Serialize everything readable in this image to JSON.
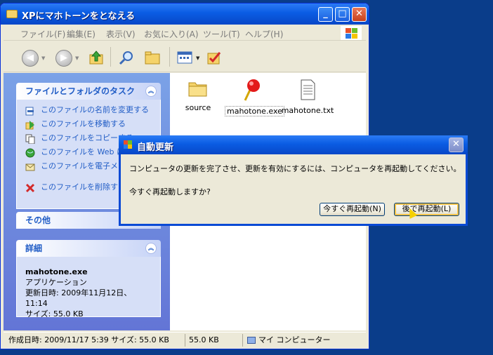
{
  "window": {
    "title": "XPにマホトーンをとなえる",
    "buttons": {
      "minimize": "_",
      "maximize": "□",
      "close": "✕"
    }
  },
  "menu": [
    "ファイル(F)",
    "編集(E)",
    "表示(V)",
    "お気に入り(A)",
    "ツール(T)",
    "ヘルプ(H)"
  ],
  "toolbar": {
    "back": "icon",
    "forward": "icon"
  },
  "task_panel": {
    "title": "ファイルとフォルダのタスク",
    "items": [
      "このファイルの名前を変更する",
      "このファイルを移動する",
      "このファイルをコピーする",
      "このファイルを Web に公",
      "このファイルを電子メール する",
      "このファイルを削除する"
    ]
  },
  "other_panel": {
    "title": "その他"
  },
  "details_panel": {
    "title": "詳細",
    "name": "mahotone.exe",
    "type": "アプリケーション",
    "modified": "更新日時: 2009年11月12日、11:14",
    "size": "サイズ: 55.0 KB"
  },
  "files": [
    {
      "label": "source",
      "icon": "folder-icon"
    },
    {
      "label": "mahotone.exe",
      "icon": "pin-icon"
    },
    {
      "label": "mahotone.txt",
      "icon": "text-file-icon"
    }
  ],
  "status": {
    "info": "作成日時: 2009/11/17 5:39 サイズ: 55.0 KB",
    "size": "55.0 KB",
    "location": "マイ コンピューター"
  },
  "dialog": {
    "title": "自動更新",
    "message": "コンピュータの更新を完了させ、更新を有効にするには、コンピュータを再起動してください。",
    "question": "今すぐ再起動しますか?",
    "restart_now": "今すぐ再起動(N)",
    "restart_later": "後で再起動(L)"
  }
}
